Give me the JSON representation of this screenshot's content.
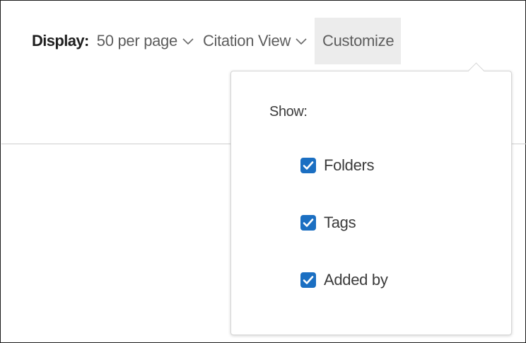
{
  "toolbar": {
    "display_label": "Display:",
    "per_page_label": "50 per page",
    "view_label": "Citation View",
    "customize_label": "Customize"
  },
  "customize_panel": {
    "show_label": "Show:",
    "options": [
      {
        "label": "Folders",
        "checked": true
      },
      {
        "label": "Tags",
        "checked": true
      },
      {
        "label": "Added by",
        "checked": true
      }
    ]
  },
  "colors": {
    "checkbox": "#1b6fc2",
    "customize_bg": "#ececec",
    "text_muted": "#5d5d5d"
  },
  "icons": [
    "chevron-down-icon",
    "checkmark-icon"
  ]
}
